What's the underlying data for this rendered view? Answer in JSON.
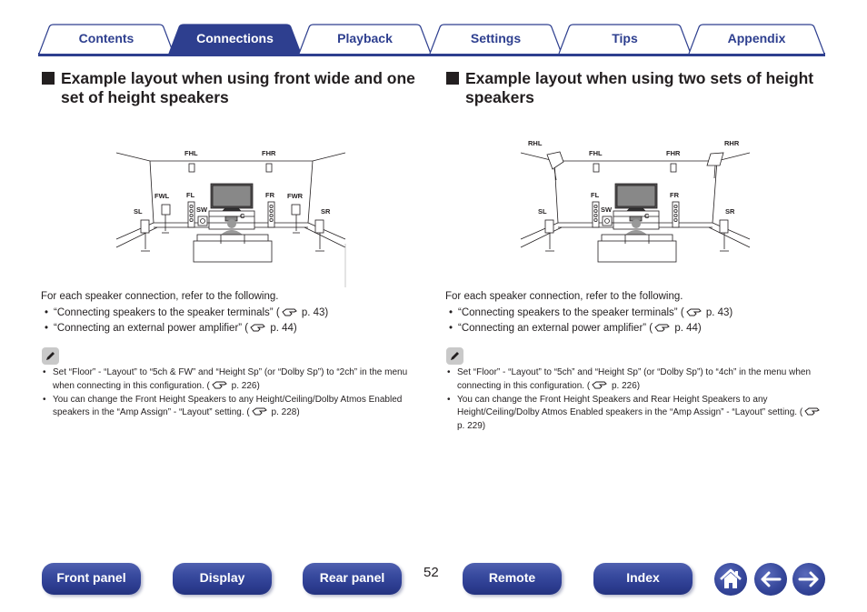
{
  "tabs": [
    {
      "label": "Contents",
      "active": false
    },
    {
      "label": "Connections",
      "active": true
    },
    {
      "label": "Playback",
      "active": false
    },
    {
      "label": "Settings",
      "active": false
    },
    {
      "label": "Tips",
      "active": false
    },
    {
      "label": "Appendix",
      "active": false
    }
  ],
  "colors": {
    "brand_blue": "#2e3f8f",
    "text": "#231f20",
    "note_icon_bg": "#c9c9c9"
  },
  "left": {
    "heading": "Example layout when using front wide and one set of height speakers",
    "diagram": {
      "labels": {
        "fhl": "FHL",
        "fhr": "FHR",
        "fwl": "FWL",
        "fwr": "FWR",
        "fl": "FL",
        "fr": "FR",
        "sl": "SL",
        "sr": "SR",
        "sw": "SW",
        "c": "C"
      }
    },
    "intro": "For each speaker connection, refer to the following.",
    "refs": [
      {
        "text": "“Connecting speakers to the speaker terminals” (",
        "page": " p. 43)"
      },
      {
        "text": "“Connecting an external power amplifier” (",
        "page": " p. 44)"
      }
    ],
    "notes": [
      {
        "text": "Set “Floor” - “Layout” to “5ch & FW” and “Height Sp” (or “Dolby Sp”) to “2ch” in the menu when connecting in this configuration.  (",
        "page": " p. 226)"
      },
      {
        "text": "You can change the Front Height Speakers to any Height/Ceiling/Dolby Atmos Enabled speakers in the “Amp Assign” - “Layout” setting.  (",
        "page": " p. 228)"
      }
    ]
  },
  "right": {
    "heading": "Example layout when using two sets of height speakers",
    "diagram": {
      "labels": {
        "rhl": "RHL",
        "rhr": "RHR",
        "fhl": "FHL",
        "fhr": "FHR",
        "fl": "FL",
        "fr": "FR",
        "sl": "SL",
        "sr": "SR",
        "sw": "SW",
        "c": "C"
      }
    },
    "intro": "For each speaker connection, refer to the following.",
    "refs": [
      {
        "text": "“Connecting speakers to the speaker terminals” (",
        "page": " p. 43)"
      },
      {
        "text": "“Connecting an external power amplifier” (",
        "page": " p. 44)"
      }
    ],
    "notes": [
      {
        "text": "Set “Floor” - “Layout” to “5ch” and “Height Sp” (or “Dolby Sp”) to “4ch” in the menu when connecting in this configuration.  (",
        "page": " p. 226)"
      },
      {
        "text": "You can change the Front Height Speakers and Rear Height Speakers to any Height/Ceiling/Dolby Atmos Enabled speakers in the “Amp Assign” - “Layout” setting.  (",
        "page": " p. 229)"
      }
    ]
  },
  "bottom_nav": {
    "buttons": [
      {
        "label": "Front panel"
      },
      {
        "label": "Display"
      },
      {
        "label": "Rear panel"
      },
      {
        "label": "Remote"
      },
      {
        "label": "Index"
      }
    ],
    "page_number": "52",
    "icons": {
      "home": "home-icon",
      "back": "arrow-left-icon",
      "forward": "arrow-right-icon"
    }
  }
}
